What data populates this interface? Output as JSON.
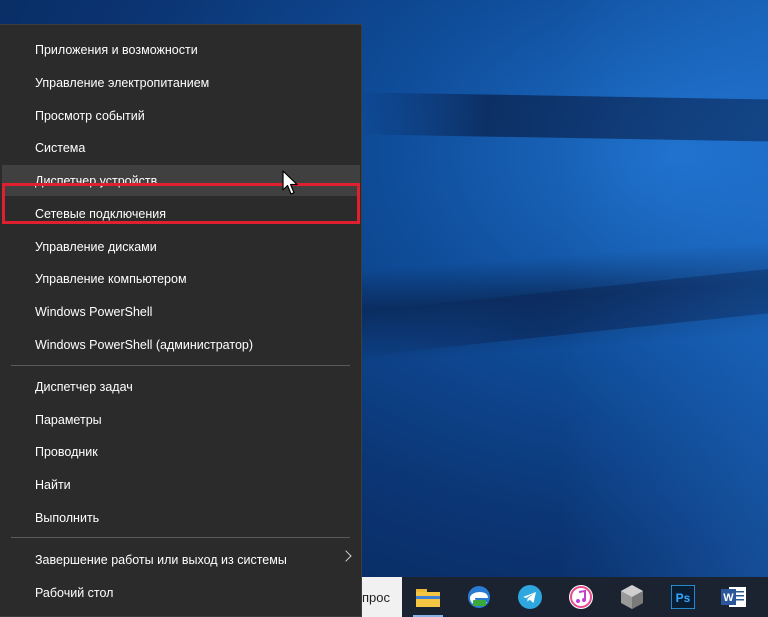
{
  "menu": {
    "group1": [
      {
        "label": "Приложения и возможности"
      },
      {
        "label": "Управление электропитанием"
      },
      {
        "label": "Просмотр событий"
      },
      {
        "label": "Система"
      },
      {
        "label": "Диспетчер устройств"
      },
      {
        "label": "Сетевые подключения"
      },
      {
        "label": "Управление дисками"
      },
      {
        "label": "Управление компьютером"
      },
      {
        "label": "Windows PowerShell"
      },
      {
        "label": "Windows PowerShell (администратор)"
      }
    ],
    "group2": [
      {
        "label": "Диспетчер задач"
      },
      {
        "label": "Параметры"
      },
      {
        "label": "Проводник"
      },
      {
        "label": "Найти"
      },
      {
        "label": "Выполнить"
      }
    ],
    "group3": [
      {
        "label": "Завершение работы или выход из системы",
        "icon": "chevron-right-icon"
      },
      {
        "label": "Рабочий стол"
      }
    ],
    "highlighted_item": "Диспетчер устройств",
    "highlight_color": "#e0202e"
  },
  "taskbar": {
    "search_text": "прос",
    "icons": [
      "file-explorer-icon",
      "edge-browser-icon",
      "telegram-icon",
      "itunes-icon",
      "app-cube-icon",
      "photoshop-icon",
      "word-icon"
    ],
    "photoshop_label": "Ps",
    "word_label": "W"
  }
}
